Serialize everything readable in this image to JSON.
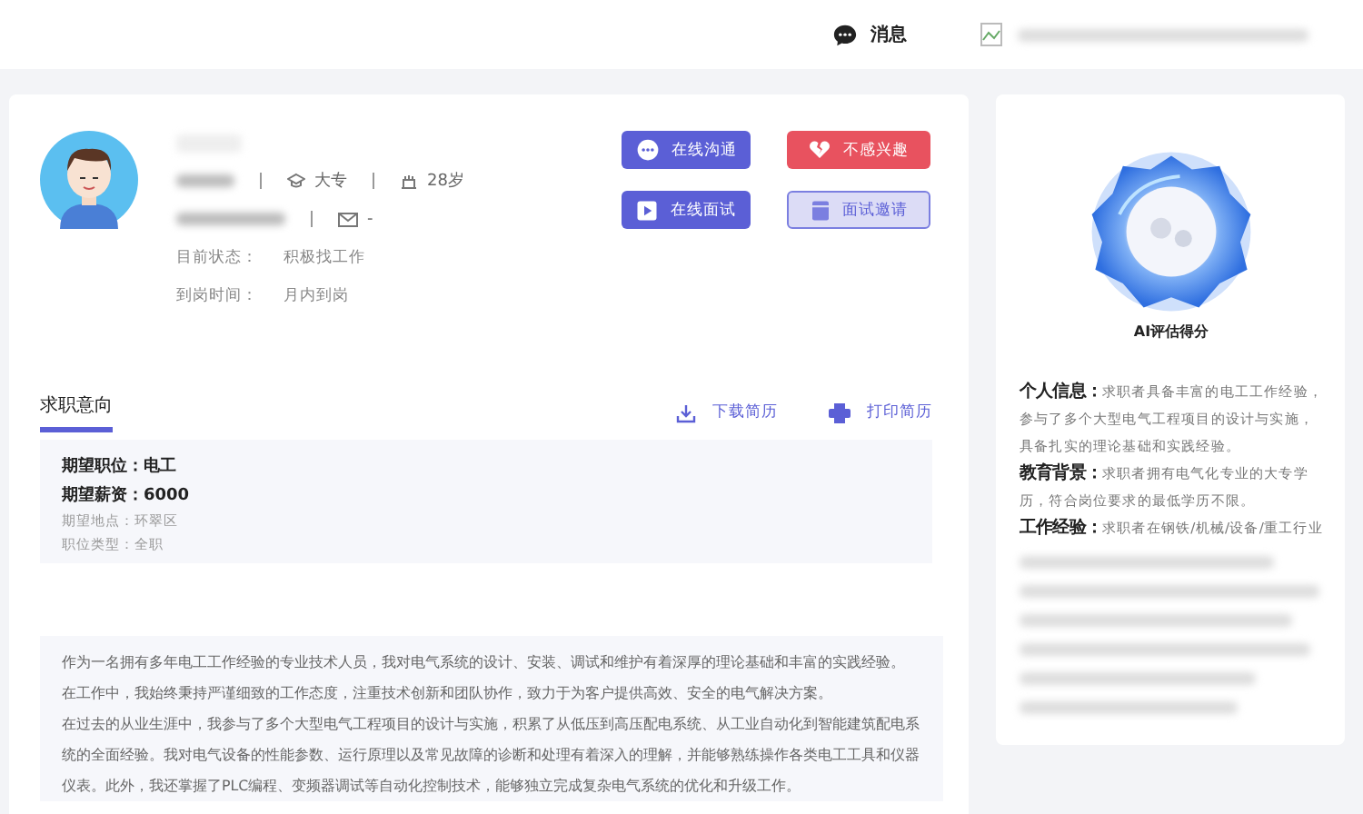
{
  "header": {
    "messages_label": "消息"
  },
  "profile": {
    "education": "大专",
    "age": "28岁",
    "email": "-",
    "status_label": "目前状态：",
    "status": "积极找工作",
    "arrival_label": "到岗时间：",
    "arrival": "月内到岗"
  },
  "actions": [
    {
      "label": "在线沟通",
      "kind": "chat"
    },
    {
      "label": "不感兴趣",
      "kind": "dislike"
    },
    {
      "label": "在线面试",
      "kind": "video"
    },
    {
      "label": "面试邀请",
      "kind": "invite"
    }
  ],
  "intent": {
    "title": "求职意向",
    "download": "下载简历",
    "print": "打印简历",
    "position": "期望职位：电工",
    "salary_label": "期望薪资：",
    "salary": "6000",
    "location": "期望地点：环翠区",
    "job_type": "职位类型：全职"
  },
  "summary": [
    "作为一名拥有多年电工工作经验的专业技术人员，我对电气系统的设计、安装、调试和维护有着深厚的理论基础和丰富的实践经验。",
    "在工作中，我始终秉持严谨细致的工作态度，注重技术创新和团队协作，致力于为客户提供高效、安全的电气解决方案。",
    "在过去的从业生涯中，我参与了多个大型电气工程项目的设计与实施，积累了从低压到高压配电系统、从工业自动化到智能建筑配电系统的全面经验。我对电气设备的性能参数、运行原理以及常见故障的诊断和处理有着深入的理解，并能够熟练操作各类电工工具和仪器仪表。此外，我还掌握了PLC编程、变频器调试等自动化控制技术，能够独立完成复杂电气系统的优化和升级工作。"
  ],
  "ai_panel": {
    "caption": "AI评估得分",
    "items": [
      {
        "label": "个人信息：",
        "text": "求职者具备丰富的电工工作经验，参与了多个大型电气工程项目的设计与实施，具备扎实的理论基础和实践经验。"
      },
      {
        "label": "教育背景：",
        "text": "求职者拥有电气化专业的大专学历，符合岗位要求的最低学历不限。"
      },
      {
        "label": "工作经验：",
        "text": "求职者在钢铁/机械/设备/重工行业"
      }
    ]
  }
}
